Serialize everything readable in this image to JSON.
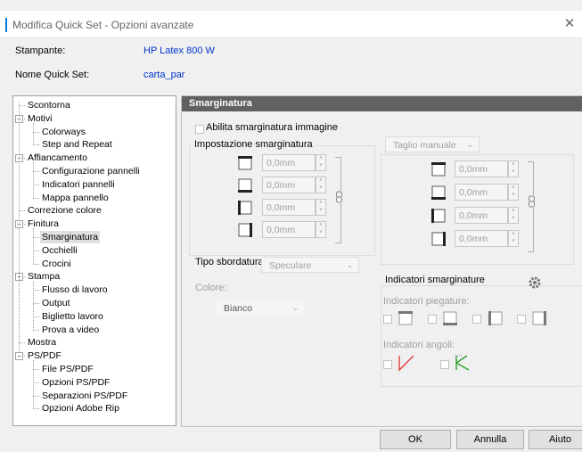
{
  "window": {
    "title": "Modifica Quick Set - Opzioni avanzate",
    "close_glyph": "✕"
  },
  "header": {
    "printer_label": "Stampante:",
    "printer_value": "HP Latex 800 W",
    "quickset_label": "Nome Quick Set:",
    "quickset_value": "carta_par"
  },
  "tree": [
    {
      "label": "Scontorna",
      "level": 0,
      "expander": ""
    },
    {
      "label": "Motivi",
      "level": 0,
      "expander": "−"
    },
    {
      "label": "Colorways",
      "level": 1,
      "expander": ""
    },
    {
      "label": "Step and Repeat",
      "level": 1,
      "expander": ""
    },
    {
      "label": "Affiancamento",
      "level": 0,
      "expander": "−"
    },
    {
      "label": "Configurazione pannelli",
      "level": 1,
      "expander": ""
    },
    {
      "label": "Indicatori pannelli",
      "level": 1,
      "expander": ""
    },
    {
      "label": "Mappa pannello",
      "level": 1,
      "expander": ""
    },
    {
      "label": "Correzione colore",
      "level": 0,
      "expander": ""
    },
    {
      "label": "Finitura",
      "level": 0,
      "expander": "−"
    },
    {
      "label": "Smarginatura",
      "level": 1,
      "expander": "",
      "selected": true
    },
    {
      "label": "Occhielli",
      "level": 1,
      "expander": ""
    },
    {
      "label": "Crocini",
      "level": 1,
      "expander": ""
    },
    {
      "label": "Stampa",
      "level": 0,
      "expander": "−"
    },
    {
      "label": "Flusso di lavoro",
      "level": 1,
      "expander": ""
    },
    {
      "label": "Output",
      "level": 1,
      "expander": ""
    },
    {
      "label": "Biglietto lavoro",
      "level": 1,
      "expander": ""
    },
    {
      "label": "Prova a video",
      "level": 1,
      "expander": ""
    },
    {
      "label": "Mostra",
      "level": 0,
      "expander": ""
    },
    {
      "label": "PS/PDF",
      "level": 0,
      "expander": "−"
    },
    {
      "label": "File PS/PDF",
      "level": 1,
      "expander": ""
    },
    {
      "label": "Opzioni PS/PDF",
      "level": 1,
      "expander": ""
    },
    {
      "label": "Separazioni PS/PDF",
      "level": 1,
      "expander": ""
    },
    {
      "label": "Opzioni Adobe Rip",
      "level": 1,
      "expander": ""
    }
  ],
  "panel": {
    "title": "Smarginatura",
    "enable_label": "Abilita smarginatura immagine",
    "settings_group": "Impostazione smarginatura",
    "left_values": [
      "0,0mm",
      "0,0mm",
      "0,0mm",
      "0,0mm"
    ],
    "mode_select": "Taglio manuale",
    "right_values": [
      "0,0mm",
      "0,0mm",
      "0,0mm",
      "0,0mm"
    ],
    "border_type_label": "Tipo sbordatura:",
    "border_type_value": "Speculare",
    "color_label": "Colore:",
    "color_value": "Bianco",
    "indicators_group": "Indicatori smarginature",
    "fold_indicators_label": "Indicatori piegature:",
    "corner_indicators_label": "Indicatori angoli:"
  },
  "buttons": {
    "ok": "OK",
    "cancel": "Annulla",
    "help": "Aiuto"
  },
  "colors": {
    "accent": "#0078d7",
    "link": "#0033cc",
    "panel_header": "#616161",
    "selected": "#e0e0e0",
    "corner_red": "#e04040",
    "corner_green": "#30a030"
  }
}
